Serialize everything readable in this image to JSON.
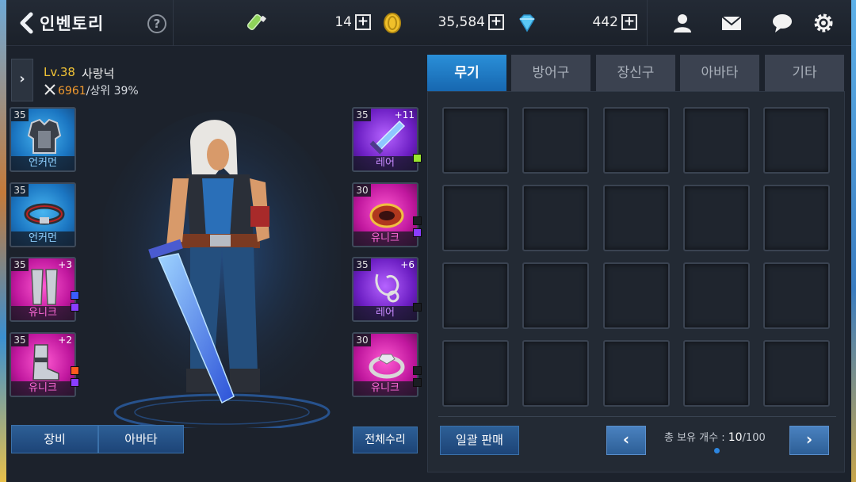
{
  "header": {
    "title": "인벤토리",
    "help_label": "?",
    "resources": [
      {
        "icon": "stamina-potion-icon",
        "value": "14"
      },
      {
        "icon": "gold-coin-icon",
        "value": "35,584"
      },
      {
        "icon": "diamond-icon",
        "value": "442"
      }
    ],
    "plus_label": "+",
    "system_icons": [
      "friends-icon",
      "mail-icon",
      "chat-icon",
      "settings-icon"
    ]
  },
  "character": {
    "level": "Lv.38",
    "name": "사랑넉",
    "combat_power": "6961",
    "rank": "/상위 39%",
    "expand_label": "›"
  },
  "equipment_left": [
    {
      "level": "35",
      "plus": "",
      "grade": "언커먼",
      "color": "blue",
      "icon": "chest-armor-icon"
    },
    {
      "level": "35",
      "plus": "",
      "grade": "언커먼",
      "color": "blue",
      "icon": "belt-icon"
    },
    {
      "level": "35",
      "plus": "+3",
      "grade": "유니크",
      "color": "pink",
      "icon": "leg-armor-icon"
    },
    {
      "level": "35",
      "plus": "+2",
      "grade": "유니크",
      "color": "pink",
      "icon": "boots-icon"
    }
  ],
  "equipment_right": [
    {
      "level": "35",
      "plus": "+11",
      "grade": "레어",
      "color": "purple",
      "icon": "sword-icon"
    },
    {
      "level": "30",
      "plus": "",
      "grade": "유니크",
      "color": "pink",
      "icon": "bracelet-icon"
    },
    {
      "level": "35",
      "plus": "+6",
      "grade": "레어",
      "color": "purple",
      "icon": "necklace-icon"
    },
    {
      "level": "30",
      "plus": "",
      "grade": "유니크",
      "color": "pink",
      "icon": "ring-icon"
    }
  ],
  "bottom_buttons": {
    "equip": "장비",
    "avatar": "아바타",
    "repair_all": "전체수리"
  },
  "inventory": {
    "tabs": [
      "무기",
      "방어구",
      "장신구",
      "아바타",
      "기타"
    ],
    "active_tab": "무기",
    "sell_all": "일괄 판매",
    "count_label": "총 보유 개수 : ",
    "count_current": "10",
    "count_max": "/100",
    "prev_label": "‹",
    "next_label": "›"
  },
  "colors": {
    "accent_blue": "#1f7fce",
    "gold_text": "#f3c536",
    "combat_orange": "#f29a2e"
  }
}
